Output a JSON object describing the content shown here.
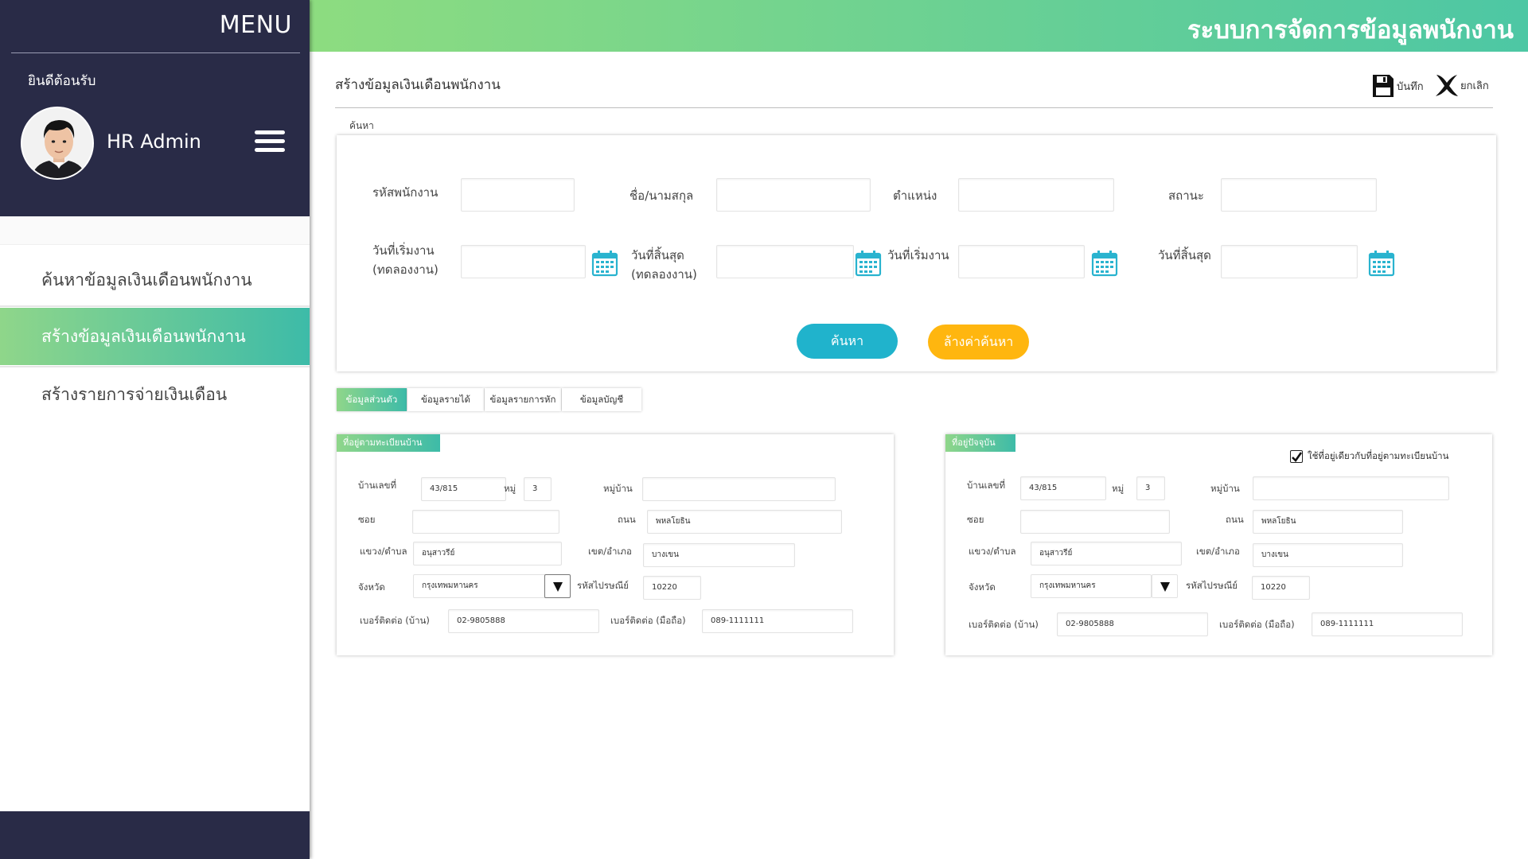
{
  "sidebar": {
    "menu_title": "MENU",
    "welcome": "ยินดีต้อนรับ",
    "user_name": "HR Admin",
    "nav": [
      {
        "label": "ค้นหาข้อมูลเงินเดือนพนักงาน",
        "active": false
      },
      {
        "label": "สร้างข้อมูลเงินเดือนพนักงาน",
        "active": true
      },
      {
        "label": "สร้างรายการจ่ายเงินเดือน",
        "active": false
      }
    ]
  },
  "header": {
    "system_title": "ระบบการจัดการข้อมูลพนักงาน"
  },
  "page": {
    "title": "สร้างข้อมูลเงินเดือนพนักงาน",
    "save_label": "บันทึก",
    "cancel_label": "ยกเลิก"
  },
  "search": {
    "section_label": "ค้นหา",
    "employee_id_label": "รหัสพนักงาน",
    "name_label": "ชื่อ/นามสกุล",
    "position_label": "ตำแหน่ง",
    "status_label": "สถานะ",
    "probation_start_line1": "วันที่เริ่มงาน",
    "probation_start_line2": "(ทดลองงาน)",
    "probation_end_line1": "วันที่สิ้นสุด",
    "probation_end_line2": "(ทดลองงาน)",
    "start_label": "วันที่เริ่มงาน",
    "end_label": "วันที่สิ้นสุด",
    "search_button": "ค้นหา",
    "clear_button": "ล้างค่าค้นหา"
  },
  "tabs": [
    {
      "label": "ข้อมูลส่วนตัว",
      "active": true
    },
    {
      "label": "ข้อมูลรายได้",
      "active": false
    },
    {
      "label": "ข้อมูลรายการหัก",
      "active": false
    },
    {
      "label": "ข้อมูลบัญชี",
      "active": false
    }
  ],
  "registered_address": {
    "tag": "ที่อยู่ตามทะเบียนบ้าน",
    "house_no_label": "บ้านเลขที่",
    "house_no": "43/815",
    "moo_label": "หมู่",
    "moo": "3",
    "village_label": "หมู่บ้าน",
    "village": "",
    "soi_label": "ซอย",
    "soi": "",
    "road_label": "ถนน",
    "road": "พหลโยธิน",
    "subdistrict_label": "แขวง/ตำบล",
    "subdistrict": "อนุสาวรีย์",
    "district_label": "เขต/อำเภอ",
    "district": "บางเขน",
    "province_label": "จังหวัด",
    "province": "กรุงเทพมหานคร",
    "postal_label": "รหัสไปรษณีย์",
    "postal": "10220",
    "phone_home_label": "เบอร์ติดต่อ (บ้าน)",
    "phone_home": "02-9805888",
    "phone_mobile_label": "เบอร์ติดต่อ (มือถือ)",
    "phone_mobile": "089-1111111"
  },
  "current_address": {
    "tag": "ที่อยู่ปัจจุบัน",
    "same_as_registered": "ใช้ที่อยู่เดียวกับที่อยู่ตามทะเบียนบ้าน",
    "same_checked": true,
    "house_no_label": "บ้านเลขที่",
    "house_no": "43/815",
    "moo_label": "หมู่",
    "moo": "3",
    "village_label": "หมู่บ้าน",
    "village": "",
    "soi_label": "ซอย",
    "soi": "",
    "road_label": "ถนน",
    "road": "พหลโยธิน",
    "subdistrict_label": "แขวง/ตำบล",
    "subdistrict": "อนุสาวรีย์",
    "district_label": "เขต/อำเภอ",
    "district": "บางเขน",
    "province_label": "จังหวัด",
    "province": "กรุงเทพมหานคร",
    "postal_label": "รหัสไปรษณีย์",
    "postal": "10220",
    "phone_home_label": "เบอร์ติดต่อ (บ้าน)",
    "phone_home": "02-9805888",
    "phone_mobile_label": "เบอร์ติดต่อ (มือถือ)",
    "phone_mobile": "089-1111111"
  },
  "icons": {
    "save": "floppy-disk-icon",
    "cancel": "x-mark-icon",
    "calendar": "calendar-icon",
    "menu": "hamburger-icon"
  },
  "colors": {
    "sidebar_bg": "#292b47",
    "accent_green": "#8fd68a",
    "accent_teal": "#3dbba8",
    "search_button": "#20b3cc",
    "clear_button": "#ffb60f"
  }
}
